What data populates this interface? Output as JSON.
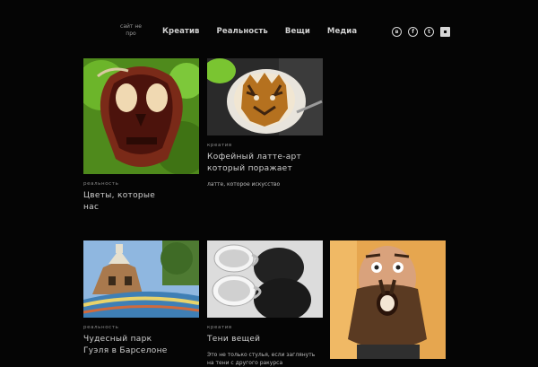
{
  "header": {
    "logo_line1": "сайт не",
    "logo_line2": "про",
    "nav": [
      "Креатив",
      "Реальность",
      "Вещи",
      "Медиа"
    ],
    "social": [
      {
        "icon": "vk-icon",
        "glyph": "в"
      },
      {
        "icon": "facebook-icon",
        "glyph": "f"
      },
      {
        "icon": "twitter-icon",
        "glyph": "t"
      },
      {
        "icon": "rss-icon",
        "glyph": "▪"
      }
    ]
  },
  "cards": [
    {
      "category": "реальность",
      "title": "Цветы, которые",
      "title2": "нас",
      "desc": ""
    },
    {
      "category": "креатив",
      "title": "Кофейный латте-арт",
      "title2": "который поражает",
      "desc": "латте, которое искусство"
    },
    {
      "category": "реальность",
      "title": "Чудесный парк",
      "title2": "Гуэля в Барселоне",
      "desc": ""
    },
    {
      "category": "креатив",
      "title": "Тени вещей",
      "title2": "",
      "desc": "Это не только стулья, если заглянуть на тени с другого ракурса"
    },
    {
      "category": "",
      "title": "",
      "title2": "",
      "desc": ""
    }
  ]
}
